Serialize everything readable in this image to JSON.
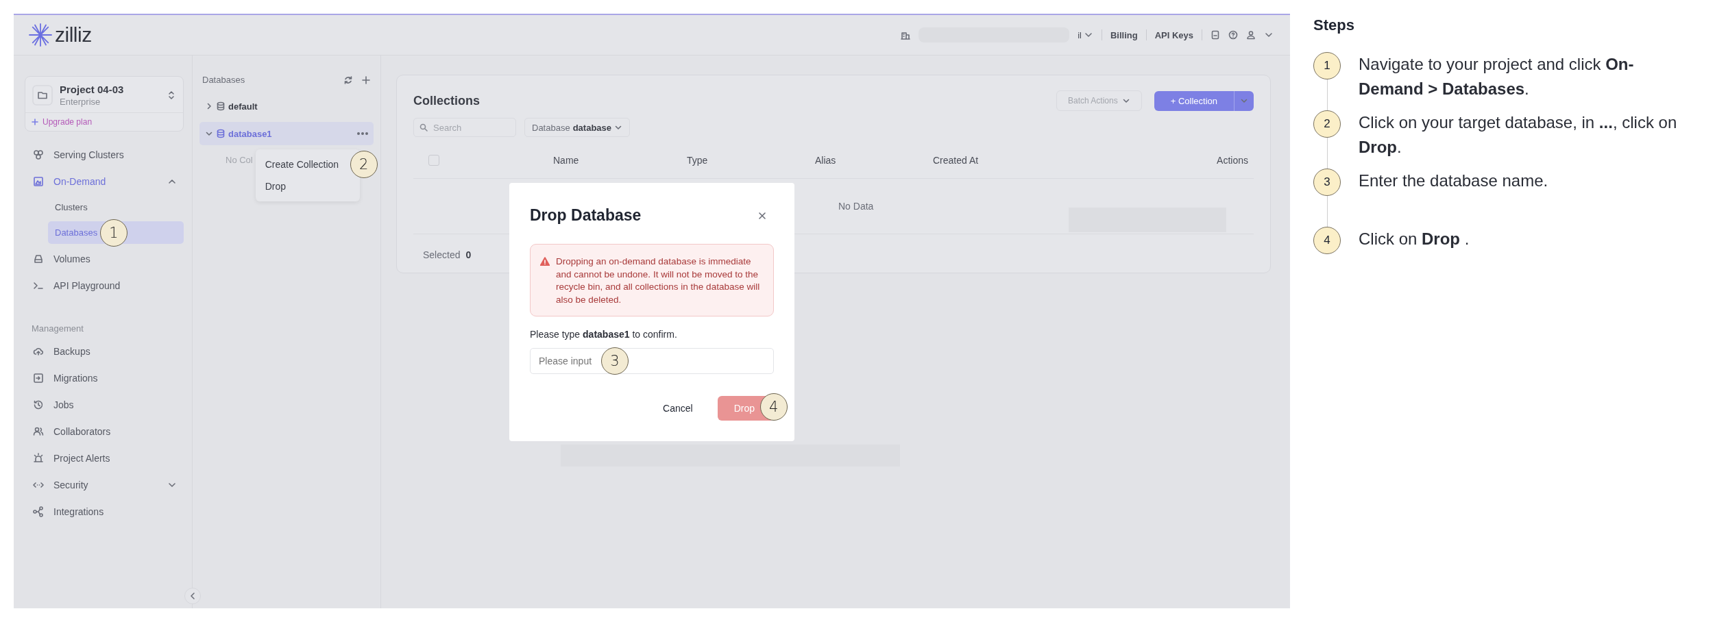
{
  "app": {
    "logo_text": "zilliz",
    "topbar": {
      "org_menu": "il",
      "links": [
        "Billing",
        "API Keys"
      ]
    },
    "sidebar": {
      "project": {
        "name": "Project 04-03",
        "plan": "Enterprise"
      },
      "upgrade_link": "Upgrade plan",
      "groups": [
        {
          "items": [
            {
              "label": "Serving Clusters",
              "selected": false
            },
            {
              "label": "On-Demand",
              "selected": true,
              "expanded": true,
              "children": [
                {
                  "label": "Clusters",
                  "selected": false
                },
                {
                  "label": "Databases",
                  "selected": true,
                  "callout": "1"
                }
              ]
            },
            {
              "label": "Volumes",
              "selected": false
            },
            {
              "label": "API Playground",
              "selected": false
            }
          ]
        },
        {
          "heading": "Management",
          "items": [
            {
              "label": "Backups",
              "selected": false
            },
            {
              "label": "Migrations",
              "selected": false
            },
            {
              "label": "Jobs",
              "selected": false
            },
            {
              "label": "Collaborators",
              "selected": false
            },
            {
              "label": "Project Alerts",
              "selected": false
            },
            {
              "label": "Security",
              "selected": false,
              "expanded": false
            },
            {
              "label": "Integrations",
              "selected": false
            }
          ]
        }
      ]
    },
    "databases": {
      "title": "Databases",
      "tree": [
        {
          "label": "default",
          "expanded": false,
          "selected": false
        },
        {
          "label": "database1",
          "expanded": true,
          "selected": true,
          "children": [
            {
              "label": "No Col"
            }
          ]
        }
      ],
      "context_menu": [
        {
          "label": "Create Collection",
          "callout": "2"
        },
        {
          "label": "Drop"
        }
      ]
    },
    "collections": {
      "title": "Collections",
      "batch_button": "Batch Actions",
      "create_button": "+ Collection",
      "search_placeholder": "Search",
      "db_filter": {
        "label": "Database",
        "value": "database"
      },
      "select_all": {
        "checked": false
      },
      "columns": [
        "Name",
        "Type",
        "Alias",
        "Created At",
        "Actions"
      ],
      "empty_text": "No Data",
      "footer": {
        "label": "Selected",
        "count": "0"
      }
    },
    "modal": {
      "title": "Drop Database",
      "alert": "Dropping an on-demand database is immediate and cannot be undone. It will not be moved to the recycle bin, and all collections in the database will also be deleted.",
      "prompt": "Please type **database1** to confirm.",
      "input": {
        "placeholder": "Please input",
        "callout": "3"
      },
      "cancel_button": "Cancel",
      "drop_button": {
        "label": "Drop",
        "disabled": true,
        "callout": "4"
      }
    }
  },
  "steps": {
    "title": "Steps",
    "items": [
      {
        "number": "1",
        "text": "Navigate to your project and click **On-Demand > Databases**."
      },
      {
        "number": "2",
        "text": "Click on your target database, in **...**, click on **Drop**."
      },
      {
        "number": "3",
        "text": "Enter the database name."
      },
      {
        "number": "4",
        "text": "Click on **Drop** ."
      }
    ]
  }
}
